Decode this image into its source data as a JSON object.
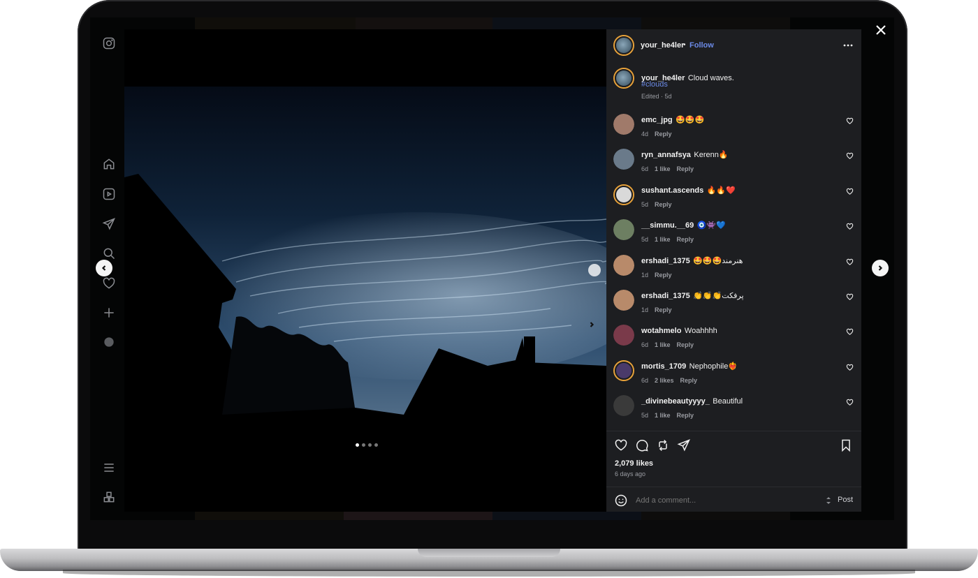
{
  "post": {
    "author": "your_he4ler",
    "follow_label": "Follow",
    "separator": "•",
    "caption_text": "Cloud waves.",
    "hashtag": "#clouds",
    "caption_meta": "Edited · 5d",
    "likes": "2,079 likes",
    "time_ago": "6 days ago",
    "carousel": {
      "count": 4,
      "active": 1
    }
  },
  "comments": [
    {
      "user": "emc_jpg",
      "text": "🤩🤩🤩",
      "age": "4d",
      "likes": "",
      "reply": "Reply",
      "story_ring": false
    },
    {
      "user": "ryn_annafsya",
      "text": "Kerenn🔥",
      "age": "6d",
      "likes": "1 like",
      "reply": "Reply",
      "story_ring": false
    },
    {
      "user": "sushant.ascends",
      "text": "🔥🔥❤️",
      "age": "5d",
      "likes": "",
      "reply": "Reply",
      "story_ring": true
    },
    {
      "user": "__simmu.__69",
      "text": "🧿👾💙",
      "age": "5d",
      "likes": "1 like",
      "reply": "Reply",
      "story_ring": false
    },
    {
      "user": "ershadi_1375",
      "text": "🤩🤩🤩هنرمند",
      "age": "1d",
      "likes": "",
      "reply": "Reply",
      "story_ring": false
    },
    {
      "user": "ershadi_1375",
      "text": "👏👏👏پرفکت",
      "age": "1d",
      "likes": "",
      "reply": "Reply",
      "story_ring": false
    },
    {
      "user": "wotahmelo",
      "text": "Woahhhh",
      "age": "6d",
      "likes": "1 like",
      "reply": "Reply",
      "story_ring": false
    },
    {
      "user": "mortis_1709",
      "text": "Nephophile❤️‍🔥",
      "age": "6d",
      "likes": "2 likes",
      "reply": "Reply",
      "story_ring": true
    },
    {
      "user": "_divinebeautyyyy_",
      "text": "Beautiful",
      "age": "5d",
      "likes": "1 like",
      "reply": "Reply",
      "story_ring": false
    }
  ],
  "comment_input": {
    "placeholder": "Add a comment...",
    "post_label": "Post"
  },
  "icons": {
    "more": "more-horizontal-icon",
    "like": "heart-icon",
    "comment": "comment-icon",
    "repost": "repost-icon",
    "share": "share-icon",
    "save": "bookmark-icon",
    "emoji": "emoji-icon",
    "close": "close-icon"
  },
  "colors": {
    "accent": "#6c8be8",
    "panel": "#1d1e21",
    "story_ring": "#e8a23a"
  }
}
